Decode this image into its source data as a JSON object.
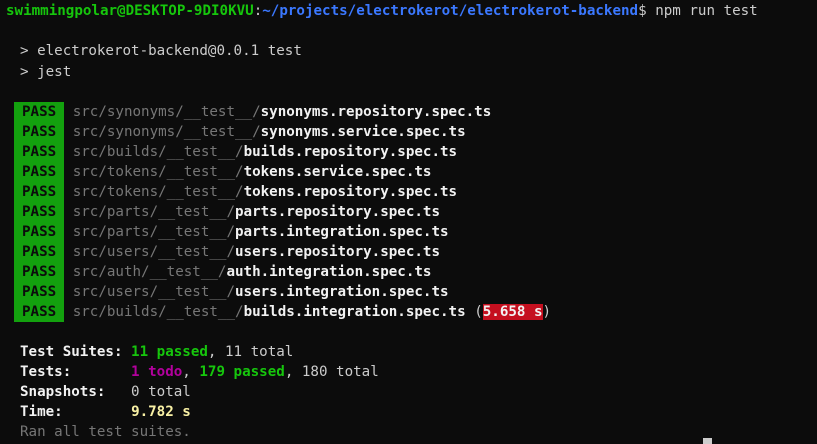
{
  "prompt": {
    "user_host": "swimmingpolar@DESKTOP-9DI0KVU",
    "separator": ":",
    "path": "~/projects/electrokerot/electrokerot-backend",
    "dollar": "$",
    "command": "npm run test"
  },
  "npm_header": {
    "line1": "> electrokerot-backend@0.0.1 test",
    "line2": "> jest"
  },
  "results": [
    {
      "status": "PASS",
      "dir": "src/synonyms/__test__/",
      "file": "synonyms.repository.spec.ts"
    },
    {
      "status": "PASS",
      "dir": "src/synonyms/__test__/",
      "file": "synonyms.service.spec.ts"
    },
    {
      "status": "PASS",
      "dir": "src/builds/__test__/",
      "file": "builds.repository.spec.ts"
    },
    {
      "status": "PASS",
      "dir": "src/tokens/__test__/",
      "file": "tokens.service.spec.ts"
    },
    {
      "status": "PASS",
      "dir": "src/tokens/__test__/",
      "file": "tokens.repository.spec.ts"
    },
    {
      "status": "PASS",
      "dir": "src/parts/__test__/",
      "file": "parts.repository.spec.ts"
    },
    {
      "status": "PASS",
      "dir": "src/parts/__test__/",
      "file": "parts.integration.spec.ts"
    },
    {
      "status": "PASS",
      "dir": "src/users/__test__/",
      "file": "users.repository.spec.ts"
    },
    {
      "status": "PASS",
      "dir": "src/auth/__test__/",
      "file": "auth.integration.spec.ts"
    },
    {
      "status": "PASS",
      "dir": "src/users/__test__/",
      "file": "users.integration.spec.ts"
    },
    {
      "status": "PASS",
      "dir": "src/builds/__test__/",
      "file": "builds.integration.spec.ts",
      "duration": "5.658 s"
    }
  ],
  "summary": {
    "suites_label": "Test Suites:",
    "suites_passed": "11 passed",
    "suites_total": ", 11 total",
    "tests_label": "Tests:",
    "tests_todo": "1 todo",
    "tests_sep": ", ",
    "tests_passed": "179 passed",
    "tests_total": ", 180 total",
    "snapshots_label": "Snapshots:",
    "snapshots_value": "0 total",
    "time_label": "Time:",
    "time_value": "9.782 s",
    "ran_all": "Ran all test suites."
  },
  "colors": {
    "background": "#0c0c0c",
    "pass_badge": "#13a10e",
    "slow_badge": "#c50f1f",
    "prompt_user": "#16c60c",
    "prompt_path": "#3b78ff",
    "todo": "#b4009e",
    "time": "#f9f1a5"
  }
}
